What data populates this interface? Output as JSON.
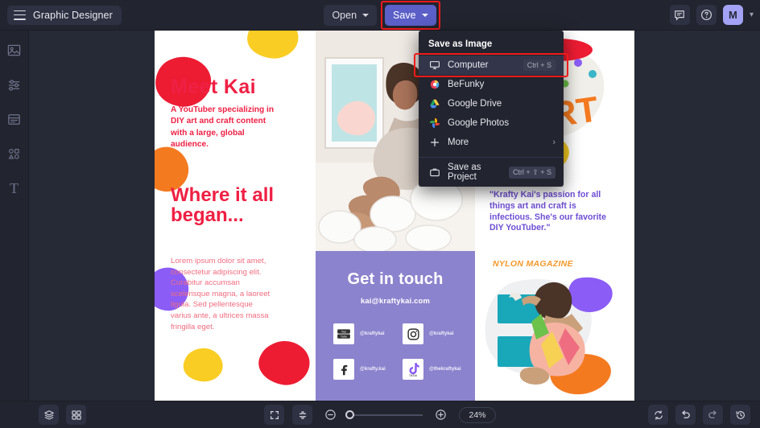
{
  "app": {
    "title": "Graphic Designer",
    "accent": "#5b5fc7",
    "annotation_color": "#f01b1b",
    "avatar_initial": "M"
  },
  "topbar": {
    "menu_icon": "hamburger-icon",
    "open_label": "Open",
    "save_label": "Save",
    "comment_icon": "comment-icon",
    "help_icon": "help-icon"
  },
  "sidebar": {
    "items": [
      {
        "icon": "image-icon",
        "name": "image"
      },
      {
        "icon": "sliders-icon",
        "name": "adjust"
      },
      {
        "icon": "template-icon",
        "name": "templates"
      },
      {
        "icon": "shapes-icon",
        "name": "graphics"
      },
      {
        "icon": "text-icon",
        "name": "text",
        "glyph": "T"
      }
    ]
  },
  "save_menu": {
    "header": "Save as Image",
    "items": [
      {
        "label": "Computer",
        "icon": "monitor-icon",
        "shortcut": "Ctrl + S",
        "highlighted": true
      },
      {
        "label": "BeFunky",
        "icon": "befunky-icon",
        "shortcut": ""
      },
      {
        "label": "Google Drive",
        "icon": "google-drive-icon",
        "shortcut": ""
      },
      {
        "label": "Google Photos",
        "icon": "google-photos-icon",
        "shortcut": ""
      },
      {
        "label": "More",
        "icon": "plus-icon",
        "shortcut": "",
        "submenu": true
      }
    ],
    "project": {
      "label": "Save as Project",
      "icon": "briefcase-icon",
      "shortcut": "Ctrl + ⇧ + S"
    }
  },
  "design": {
    "left_panel": {
      "heading": "Meet Kai",
      "subheading": "A YouTuber specializing in DIY art and craft content with a large, global audience.",
      "heading2": "Where it all began...",
      "body": "Lorem ipsum dolor sit amet, consectetur adipiscing elit. Curabitur accumsan scelerisque magna, a laoreet ligula. Sed pellentesque varius ante, a ultrices massa fringilla eget.",
      "heading_color": "#ef2044",
      "body_color": "#ef6d80"
    },
    "mid_panel": {
      "contact_heading": "Get in touch",
      "email": "kai@kraftykai.com",
      "panel_color": "#8b83cd",
      "socials": [
        {
          "network": "youtube-icon",
          "handle": "@kraftykai"
        },
        {
          "network": "instagram-icon",
          "handle": "@kraftykai"
        },
        {
          "network": "facebook-icon",
          "handle": "@krafty.kai"
        },
        {
          "network": "tiktok-icon",
          "handle": "@thekraftykai"
        }
      ]
    },
    "right_panel": {
      "art_word": "ART",
      "quote": "\"Krafty Kai's passion for all things art and craft is infectious. She's our favorite DIY YouTuber.\"",
      "source": "NYLON MAGAZINE",
      "quote_color": "#6e4fd4",
      "source_color": "#f3992b"
    }
  },
  "bottombar": {
    "layers_icon": "layers-icon",
    "grid_icon": "grid-icon",
    "fit_icon": "fit-screen-icon",
    "shrink_icon": "collapse-icon",
    "zoom_out_icon": "zoom-out-icon",
    "zoom_in_icon": "zoom-in-icon",
    "zoom_level": "24%",
    "sync_icon": "sync-icon",
    "undo_icon": "undo-icon",
    "redo_icon": "redo-icon",
    "history_icon": "history-icon"
  }
}
